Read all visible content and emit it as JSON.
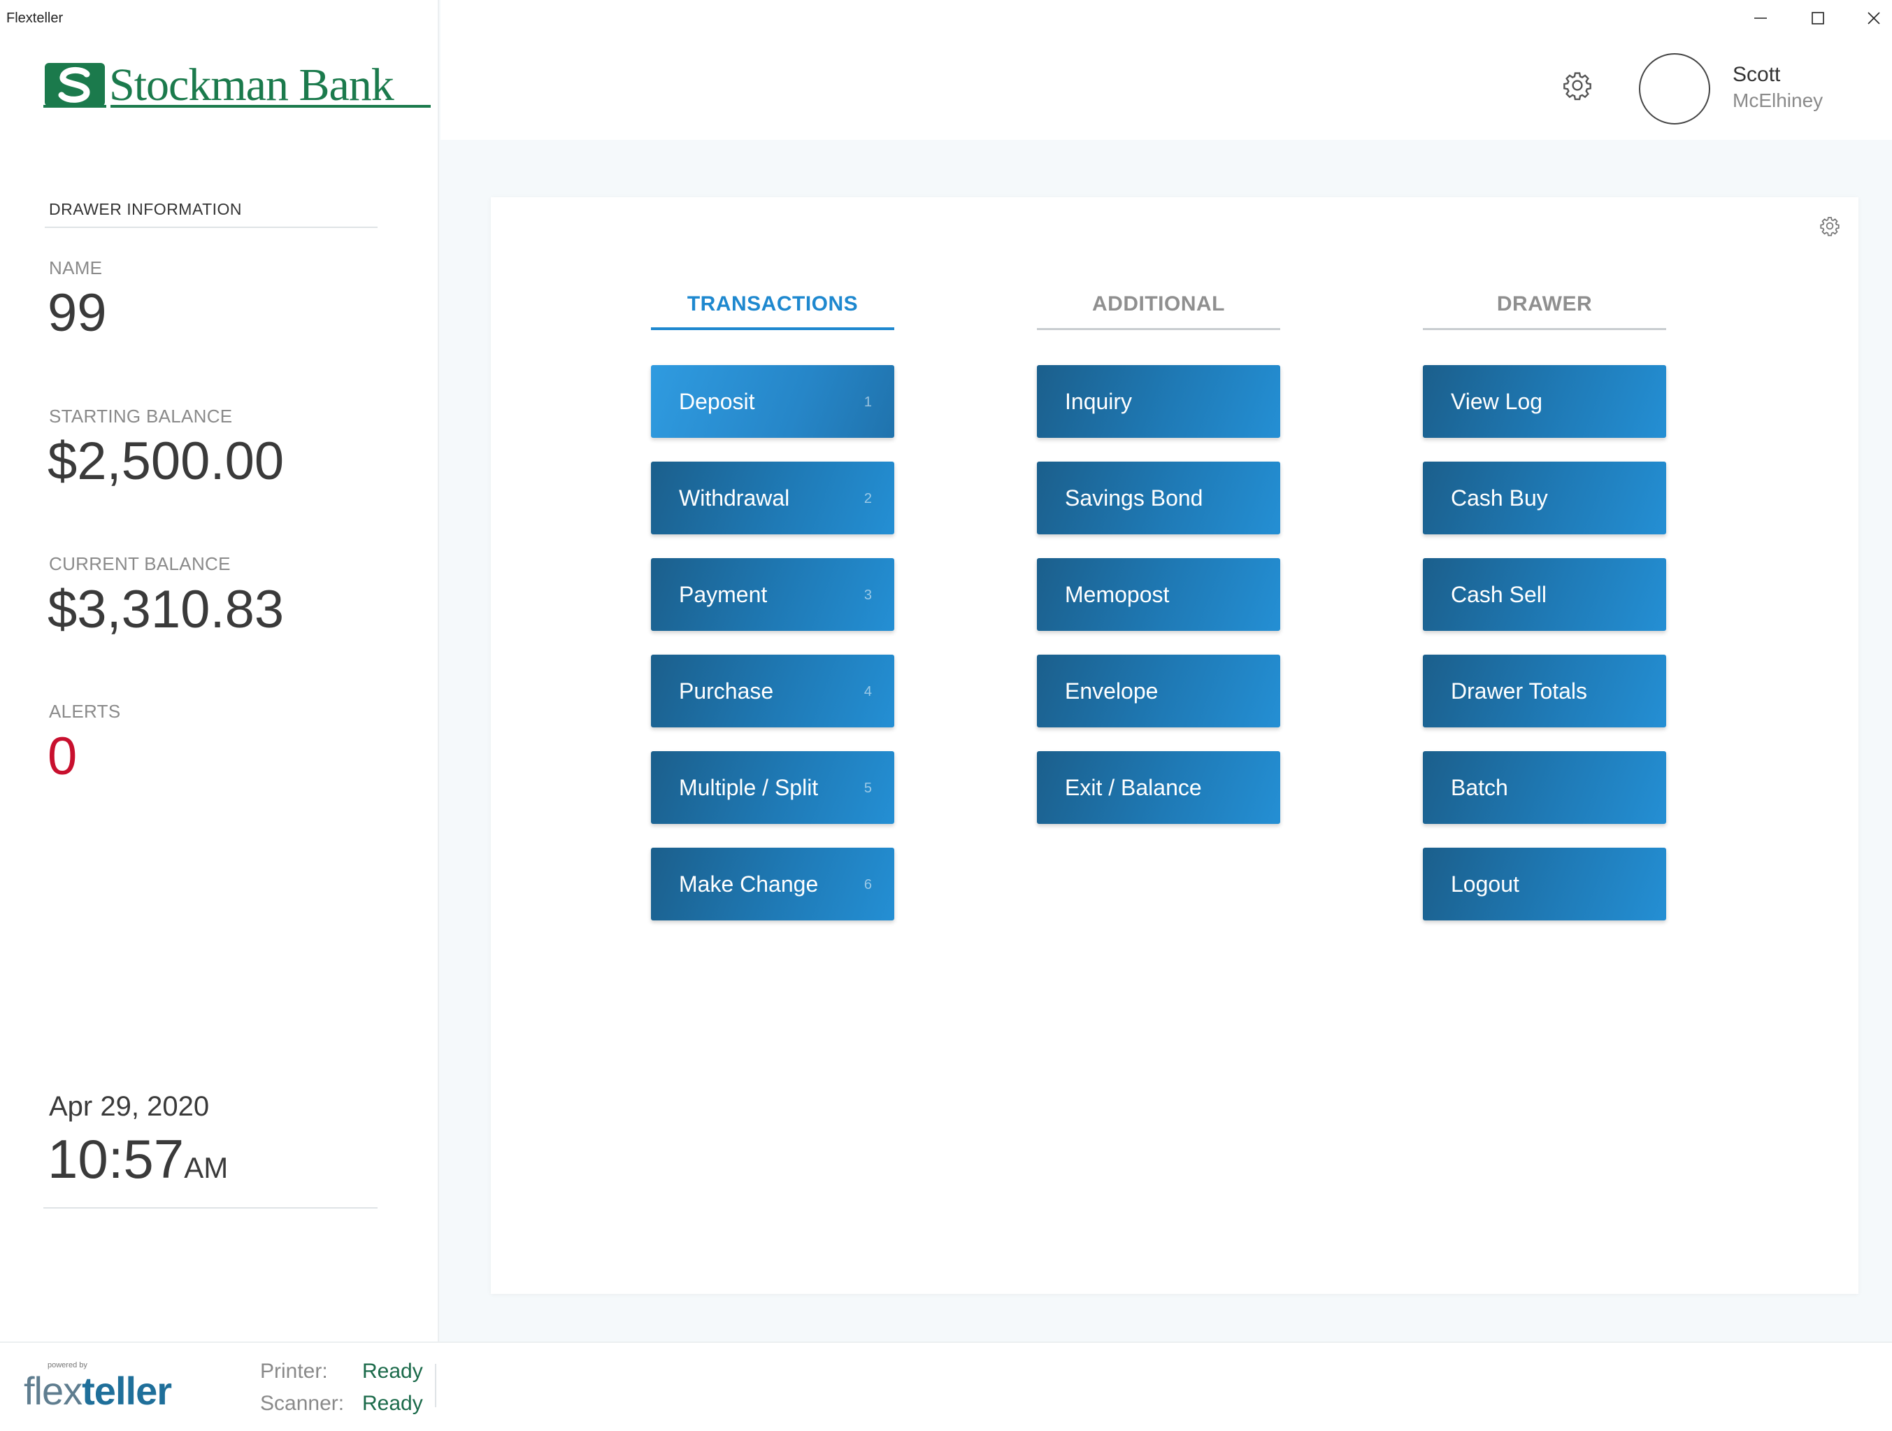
{
  "window": {
    "title": "Flexteller"
  },
  "sidebar": {
    "logo_text": "Stockman Bank",
    "drawer_heading": "DRAWER INFORMATION",
    "name_label": "NAME",
    "name_value": "99",
    "starting_balance_label": "STARTING BALANCE",
    "starting_balance_value": "$2,500.00",
    "current_balance_label": "CURRENT BALANCE",
    "current_balance_value": "$3,310.83",
    "alerts_label": "ALERTS",
    "alerts_value": "0",
    "date": "Apr 29, 2020",
    "time": "10:57",
    "ampm": "AM"
  },
  "header": {
    "user_first_name": "Scott",
    "user_last_name": "McElhiney"
  },
  "columns": [
    {
      "tab": "TRANSACTIONS",
      "buttons": [
        {
          "label": "Deposit",
          "shortcut": "1"
        },
        {
          "label": "Withdrawal",
          "shortcut": "2"
        },
        {
          "label": "Payment",
          "shortcut": "3"
        },
        {
          "label": "Purchase",
          "shortcut": "4"
        },
        {
          "label": "Multiple / Split",
          "shortcut": "5"
        },
        {
          "label": "Make Change",
          "shortcut": "6"
        }
      ]
    },
    {
      "tab": "ADDITIONAL",
      "buttons": [
        {
          "label": "Inquiry"
        },
        {
          "label": "Savings Bond"
        },
        {
          "label": "Memopost"
        },
        {
          "label": "Envelope"
        },
        {
          "label": "Exit / Balance"
        }
      ]
    },
    {
      "tab": "DRAWER",
      "buttons": [
        {
          "label": "View Log"
        },
        {
          "label": "Cash Buy"
        },
        {
          "label": "Cash Sell"
        },
        {
          "label": "Drawer Totals"
        },
        {
          "label": "Batch"
        },
        {
          "label": "Logout"
        }
      ]
    }
  ],
  "footer": {
    "powered_by": "powered by",
    "brand_part1": "flex",
    "brand_part2": "teller",
    "printer_label": "Printer:",
    "printer_status": "Ready",
    "scanner_label": "Scanner:",
    "scanner_status": "Ready"
  },
  "colors": {
    "accent": "#1e88cf",
    "button": "#1f7ab6",
    "brand_green": "#1b7a4c",
    "alert_red": "#c8102e",
    "status_green": "#1b6a4a"
  }
}
